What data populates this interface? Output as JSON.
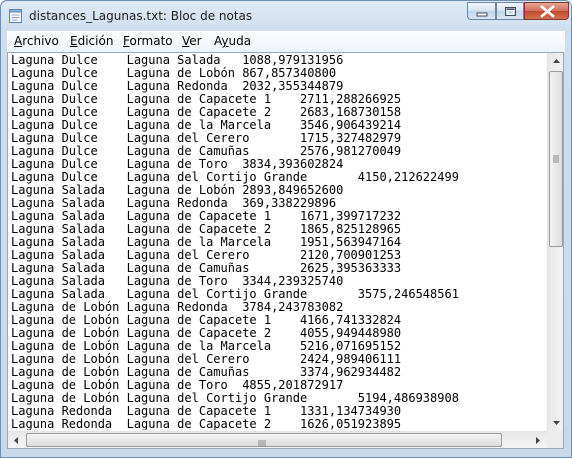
{
  "window": {
    "title": "distances_Lagunas.txt: Bloc de notas"
  },
  "menu": [
    {
      "label": "Archivo",
      "key": "A",
      "rest": "rchivo"
    },
    {
      "label": "Edición",
      "key": "E",
      "rest": "dición"
    },
    {
      "label": "Formato",
      "key": "F",
      "rest": "ormato"
    },
    {
      "label": "Ver",
      "key": "V",
      "rest": "er"
    },
    {
      "label": "Ayuda",
      "key": "y",
      "pre": "A",
      "rest": "uda"
    }
  ],
  "content": {
    "lines": [
      "Laguna Dulce\tLaguna Salada\t1088,979131956",
      "Laguna Dulce\tLaguna de Lobón\t867,857340800",
      "Laguna Dulce\tLaguna Redonda\t2032,355344879",
      "Laguna Dulce\tLaguna de Capacete 1\t2711,288266925",
      "Laguna Dulce\tLaguna de Capacete 2\t2683,168730158",
      "Laguna Dulce\tLaguna de la Marcela\t3546,906439214",
      "Laguna Dulce\tLaguna del Cerero\t1715,327482979",
      "Laguna Dulce\tLaguna de Camuñas\t2576,981270049",
      "Laguna Dulce\tLaguna de Toro\t3834,393602824",
      "Laguna Dulce\tLaguna del Cortijo Grande\t4150,212622499",
      "Laguna Salada\tLaguna de Lobón\t2893,849652600",
      "Laguna Salada\tLaguna Redonda\t369,338229896",
      "Laguna Salada\tLaguna de Capacete 1\t1671,399717232",
      "Laguna Salada\tLaguna de Capacete 2\t1865,825128965",
      "Laguna Salada\tLaguna de la Marcela\t1951,563947164",
      "Laguna Salada\tLaguna del Cerero\t2120,700901253",
      "Laguna Salada\tLaguna de Camuñas\t2625,395363333",
      "Laguna Salada\tLaguna de Toro\t3344,239325740",
      "Laguna Salada\tLaguna del Cortijo Grande\t3575,246548561",
      "Laguna de Lobón\tLaguna Redonda\t3784,243783082",
      "Laguna de Lobón\tLaguna de Capacete 1\t4166,741332824",
      "Laguna de Lobón\tLaguna de Capacete 2\t4055,949448980",
      "Laguna de Lobón\tLaguna de la Marcela\t5216,071695152",
      "Laguna de Lobón\tLaguna del Cerero\t2424,989406111",
      "Laguna de Lobón\tLaguna de Camuñas\t3374,962934482",
      "Laguna de Lobón\tLaguna de Toro\t4855,201872917",
      "Laguna de Lobón\tLaguna del Cortijo Grande\t5194,486938908",
      "Laguna Redonda\tLaguna de Capacete 1\t1331,134734930",
      "Laguna Redonda\tLaguna de Capacete 2\t1626,051923895"
    ]
  },
  "icons": {
    "app": "notepad-icon",
    "minimize": "minimize-icon",
    "maximize": "maximize-icon",
    "close": "close-icon"
  }
}
